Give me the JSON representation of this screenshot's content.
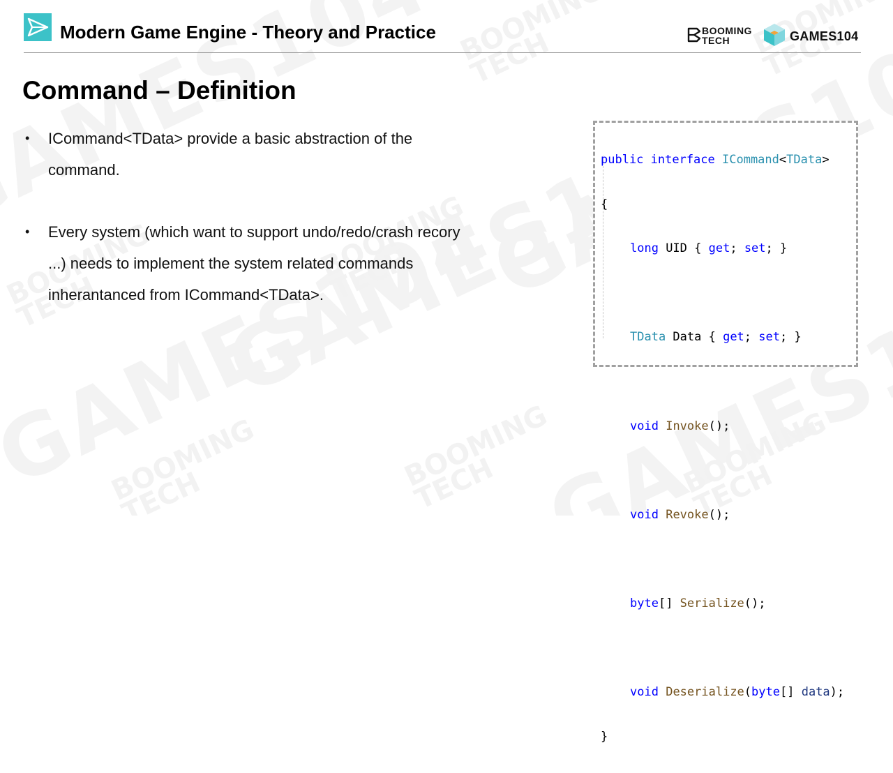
{
  "header": {
    "title": "Modern Game Engine - Theory and Practice",
    "booming_line1": "BOOMING",
    "booming_line2": "TECH",
    "games_logo": "GAMES104",
    "icon": "play-arrow-icon",
    "accent": "#3cc2c8"
  },
  "slide": {
    "title": "Command – Definition",
    "bullets": [
      {
        "text": "ICommand<TData> provide a basic abstraction of the command."
      },
      {
        "text": "Every system (which want to support undo/redo/crash recory ...) needs to implement the system related commands inherantanced from ICommand<TData>."
      }
    ]
  },
  "code": {
    "l1_kw": "public interface ",
    "l1_type": "ICommand",
    "l1_lt": "<",
    "l1_param": "TData",
    "l1_gt": ">",
    "l2": "{",
    "l3_kw": "long",
    "l3_rest": " UID { ",
    "l3_get": "get",
    "l3_sep": "; ",
    "l3_set": "set",
    "l3_end": "; }",
    "l4_type": "TData",
    "l4_rest": " Data { ",
    "l4_get": "get",
    "l4_sep": "; ",
    "l4_set": "set",
    "l4_end": "; }",
    "l5_kw": "void",
    "l5_fn": "Invoke",
    "l5_end": "();",
    "l6_kw": "void",
    "l6_fn": "Revoke",
    "l6_end": "();",
    "l7_kw": "byte",
    "l7_br": "[] ",
    "l7_fn": "Serialize",
    "l7_end": "();",
    "l8_kw": "void",
    "l8_fn": "Deserialize",
    "l8_open": "(",
    "l8_kw2": "byte",
    "l8_br": "[] ",
    "l8_param": "data",
    "l8_end": ");",
    "l9": "}"
  },
  "colors": {
    "keyword": "#0000ff",
    "type": "#2b91af",
    "method": "#74531f",
    "parameter": "#1f377f",
    "border": "#a0a0a0"
  }
}
